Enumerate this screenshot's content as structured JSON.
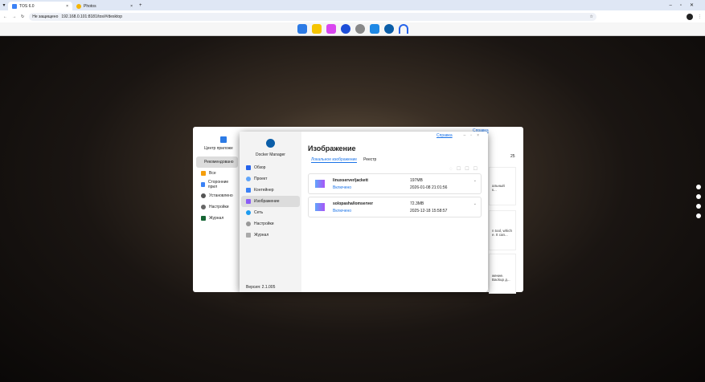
{
  "browser": {
    "tabs": [
      {
        "label": "TOS 6.0"
      },
      {
        "label": "Photos"
      }
    ],
    "security": "Не защищено",
    "url": "192.168.0.101:8181/tos/#/desktop"
  },
  "appcenter": {
    "title": "Центр приложе",
    "count": "25",
    "help": "Справка",
    "nav": [
      "Рекомендовано",
      "Все",
      "Сторонние прил",
      "Установлено",
      "Настройки",
      "Журнал"
    ],
    "snippets": [
      "альный",
      "к...",
      "n tool, which",
      "e. It can...",
      "жение.",
      "Backup д..."
    ]
  },
  "docker": {
    "app_name": "Docker Manager",
    "help": "Справка",
    "title": "Изображение",
    "tabs": [
      "Локальное изображение",
      "Реестр"
    ],
    "nav": [
      "Обзор",
      "Проект",
      "Контейнер",
      "Изображение",
      "Сеть",
      "Настройки",
      "Журнал"
    ],
    "version": "Версия: 2.1.005",
    "images": [
      {
        "name": "linuxserver/jackett",
        "status": "Включено",
        "size": "197MB",
        "date": "2026-01-08 21:01:56"
      },
      {
        "name": "solopasha/lomserver",
        "status": "Включено",
        "size": "72.3MB",
        "date": "2025-12-18 15:58:57"
      }
    ]
  },
  "colors": {
    "accent": "#1a73e8"
  }
}
